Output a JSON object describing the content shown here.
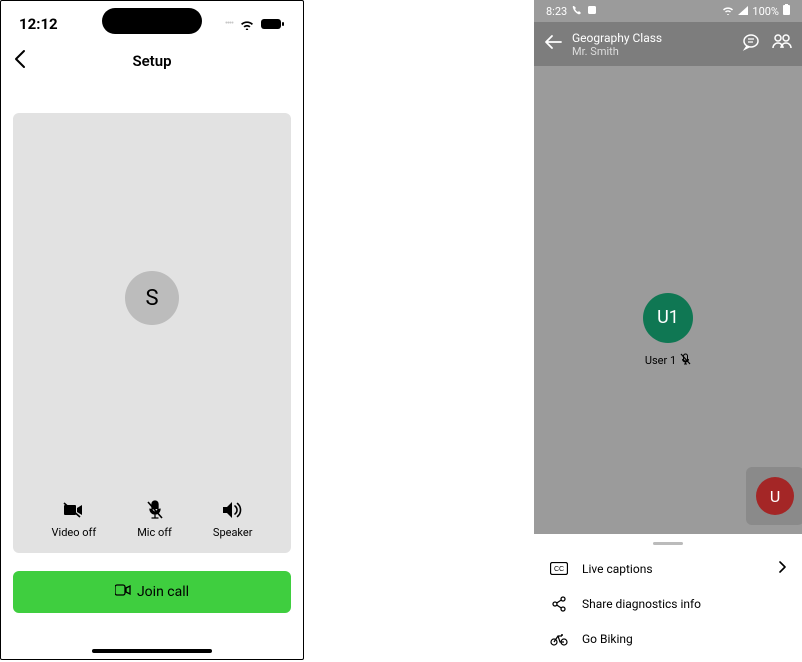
{
  "left": {
    "status": {
      "time": "12:12"
    },
    "nav": {
      "title": "Setup"
    },
    "avatar_initial": "S",
    "controls": {
      "video": "Video off",
      "mic": "Mic off",
      "speaker": "Speaker"
    },
    "join_label": "Join call"
  },
  "right": {
    "status": {
      "time": "8:23",
      "battery": "100%"
    },
    "header": {
      "title": "Geography Class",
      "subtitle": "Mr. Smith"
    },
    "participant": {
      "initial": "U1",
      "label": "User 1"
    },
    "pip_initial": "U",
    "sheet": {
      "item1": "Live captions",
      "item2": "Share diagnostics info",
      "item3": "Go Biking"
    }
  }
}
